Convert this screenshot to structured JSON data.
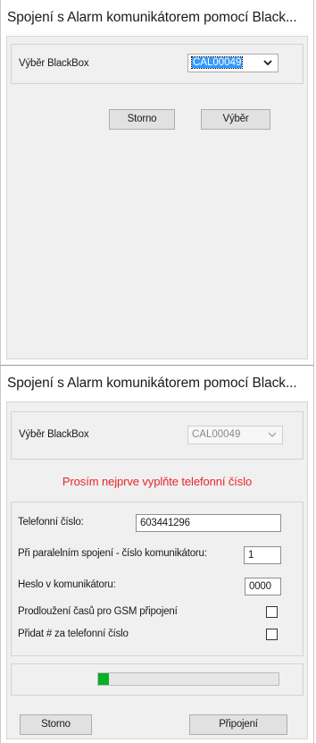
{
  "dialog1": {
    "title": "Spojení s Alarm komunikátorem pomocí Black...",
    "blackbox_label": "Výběr BlackBox",
    "blackbox_value": "CAL00049",
    "cancel_label": "Storno",
    "select_label": "Výběr"
  },
  "dialog2": {
    "title": "Spojení s Alarm komunikátorem pomocí Black...",
    "blackbox_label": "Výběr BlackBox",
    "blackbox_value": "CAL00049",
    "warning": "Prosím nejprve vyplňte telefonní číslo",
    "phone_label": "Telefonní číslo:",
    "phone_value": "603441296",
    "parallel_label": "Při paralelním spojení - číslo komunikátoru:",
    "parallel_value": "1",
    "password_label": "Heslo v komunikátoru:",
    "password_value": "0000",
    "gsm_label": "Prodloužení časů pro GSM připojení",
    "gsm_checked": false,
    "hash_label": "Přidat # za telefonní číslo",
    "hash_checked": false,
    "progress": 0.06,
    "cancel_label": "Storno",
    "connect_label": "Připojení"
  },
  "colors": {
    "warning": "#e8242c",
    "progress_fill": "#06b025",
    "selection": "#3399ff"
  },
  "icons": [
    "chevron-down-icon"
  ]
}
